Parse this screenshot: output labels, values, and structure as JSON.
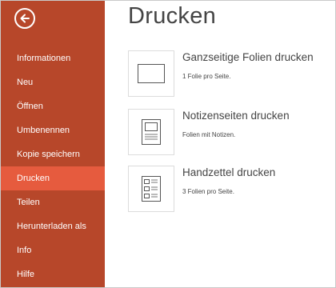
{
  "sidebar": {
    "back_icon": "back-arrow-icon",
    "items": [
      {
        "label": "Informationen"
      },
      {
        "label": "Neu"
      },
      {
        "label": "Öffnen"
      },
      {
        "label": "Umbenennen"
      },
      {
        "label": "Kopie speichern"
      },
      {
        "label": "Drucken",
        "active": true
      },
      {
        "label": "Teilen"
      },
      {
        "label": "Herunterladen als"
      },
      {
        "label": "Info"
      },
      {
        "label": "Hilfe"
      }
    ]
  },
  "main": {
    "title": "Drucken",
    "options": [
      {
        "title": "Ganzseitige Folien drucken",
        "desc": "1 Folie pro Seite.",
        "icon": "full-page-slide-icon"
      },
      {
        "title": "Notizenseiten drucken",
        "desc": "Folien mit Notizen.",
        "icon": "notes-page-icon"
      },
      {
        "title": "Handzettel drucken",
        "desc": "3 Folien pro Seite.",
        "icon": "handout-icon"
      }
    ]
  },
  "colors": {
    "sidebar_bg": "#b7472a",
    "active_item_bg": "#e65b3e",
    "text": "#444444"
  }
}
